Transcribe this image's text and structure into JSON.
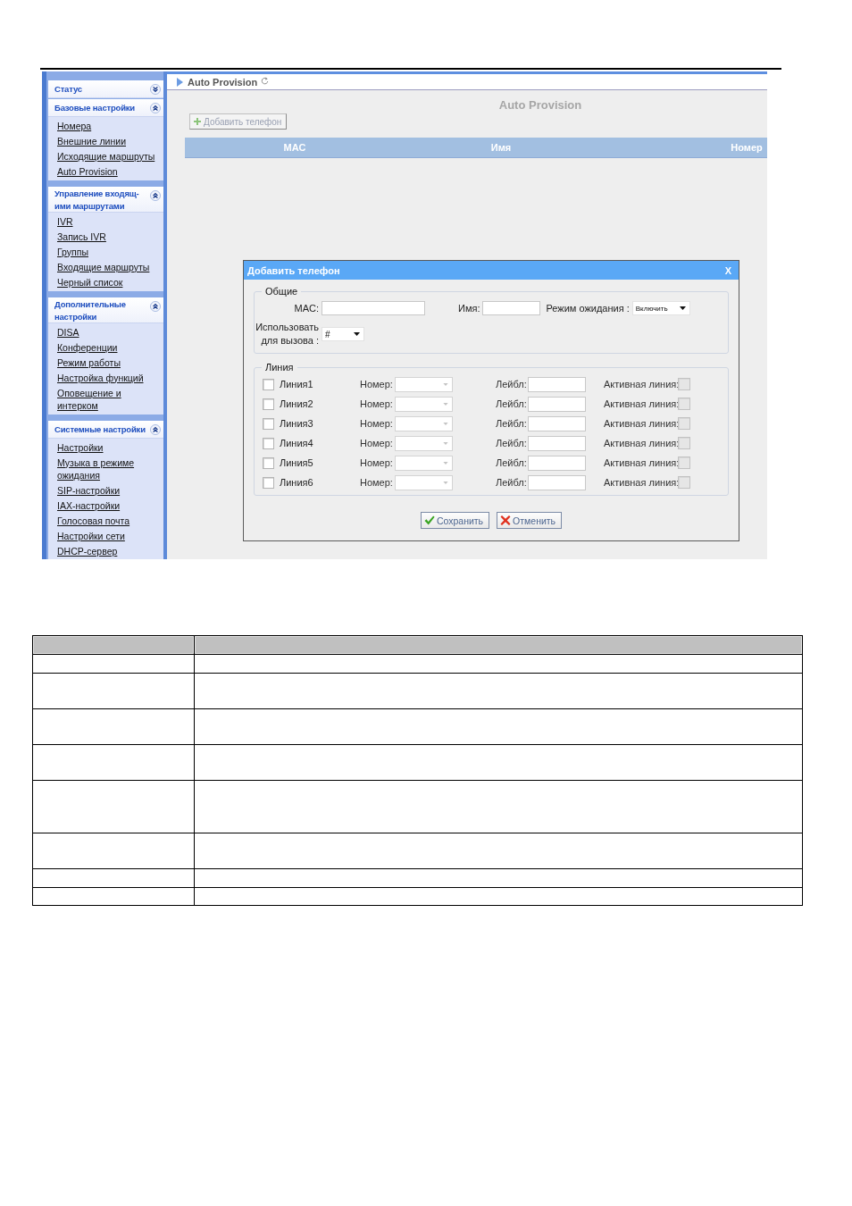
{
  "sidebar": {
    "panels": [
      {
        "title": "Статус",
        "expanded": false
      },
      {
        "title": "Базовые настройки",
        "expanded": true,
        "items": [
          "Номера",
          "Внешние линии",
          "Исходящие маршруты",
          "Auto Provision"
        ]
      },
      {
        "title": "Управление входящ-ими маршрутами",
        "expanded": true,
        "items": [
          "IVR",
          "Запись IVR",
          "Группы",
          "Входящие маршруты",
          "Черный список"
        ]
      },
      {
        "title": "Дополнительные настройки",
        "expanded": true,
        "items": [
          "DISA",
          "Конференции",
          "Режим работы",
          "Настройка функций",
          "Оповещение и интерком"
        ]
      },
      {
        "title": "Системные настройки",
        "expanded": true,
        "items": [
          "Настройки",
          "Музыка в режиме ожидания",
          "SIP-настройки",
          "IAX-настройки",
          "Голосовая почта",
          "Настройки сети",
          "DHCP-сервер"
        ]
      }
    ]
  },
  "breadcrumb": {
    "title": "Auto Provision"
  },
  "page": {
    "heading": "Auto Provision",
    "add_button": {
      "label": "Добавить телефон",
      "disabled": true
    },
    "table": {
      "columns": [
        "MAC",
        "Имя",
        "Номер"
      ]
    }
  },
  "dialog": {
    "title": "Добавить телефон",
    "close": "X",
    "general": {
      "legend": "Общие",
      "mac": {
        "label": "MAC:"
      },
      "name": {
        "label": "Имя:"
      },
      "hold_mode": {
        "label": "Режим ожидания :",
        "value": "Включить"
      },
      "call_key": {
        "label": "Использовать для вызова :",
        "value": "#"
      }
    },
    "lines": {
      "legend": "Линия",
      "rows": [
        {
          "label": "Линия1",
          "checked": false,
          "number_label": "Номер:",
          "number_disabled": true,
          "label_label": "Лейбл:",
          "active_label": "Активная линия:",
          "active_checked": false,
          "active_disabled": true
        },
        {
          "label": "Линия2",
          "checked": false,
          "number_label": "Номер:",
          "number_disabled": true,
          "label_label": "Лейбл:",
          "active_label": "Активная линия:",
          "active_checked": false,
          "active_disabled": true
        },
        {
          "label": "Линия3",
          "checked": false,
          "number_label": "Номер:",
          "number_disabled": true,
          "label_label": "Лейбл:",
          "active_label": "Активная линия:",
          "active_checked": false,
          "active_disabled": true
        },
        {
          "label": "Линия4",
          "checked": false,
          "number_label": "Номер:",
          "number_disabled": true,
          "label_label": "Лейбл:",
          "active_label": "Активная линия:",
          "active_checked": false,
          "active_disabled": true
        },
        {
          "label": "Линия5",
          "checked": false,
          "number_label": "Номер:",
          "number_disabled": true,
          "label_label": "Лейбл:",
          "active_label": "Активная линия:",
          "active_checked": false,
          "active_disabled": true
        },
        {
          "label": "Линия6",
          "checked": false,
          "number_label": "Номер:",
          "number_disabled": true,
          "label_label": "Лейбл:",
          "active_label": "Активная линия:",
          "active_checked": false,
          "active_disabled": true
        }
      ]
    },
    "buttons": [
      {
        "kind": "save",
        "label": "Сохранить"
      },
      {
        "kind": "cancel",
        "label": "Отменить"
      }
    ]
  }
}
